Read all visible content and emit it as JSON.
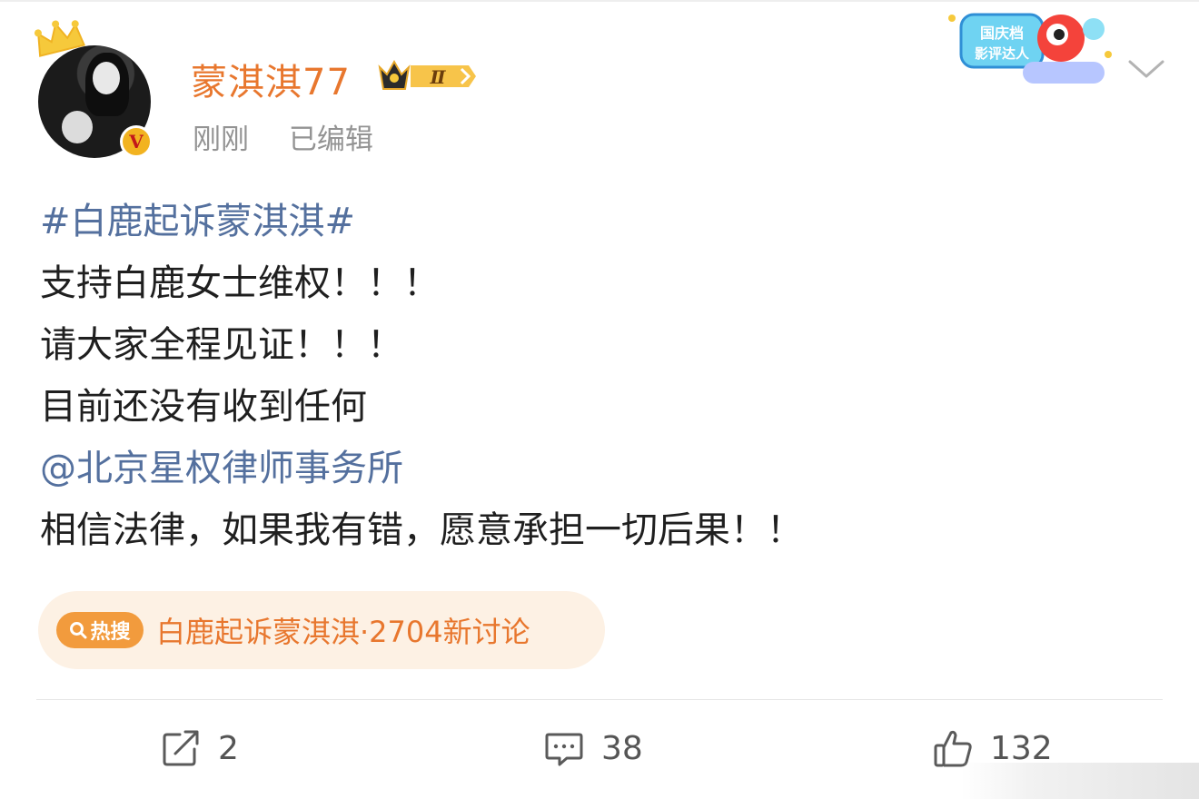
{
  "post": {
    "author": {
      "name": "蒙淇淇77",
      "verified_badge": "V",
      "vip_level": "Ⅱ"
    },
    "meta": {
      "time": "刚刚",
      "edited": "已编辑"
    },
    "promo_badge": {
      "line1": "国庆档",
      "line2": "影评达人"
    },
    "content": {
      "hashtag": "#白鹿起诉蒙淇淇#",
      "line1": "支持白鹿女士维权！！！",
      "line2": "请大家全程见证！！！",
      "line3": "目前还没有收到任何",
      "mention": "@北京星权律师事务所",
      "line4": "相信法律，如果我有错，愿意承担一切后果！！"
    },
    "hot_search": {
      "badge": "热搜",
      "text": "白鹿起诉蒙淇淇·2704新讨论"
    },
    "actions": {
      "repost_count": "2",
      "comment_count": "38",
      "like_count": "132"
    }
  },
  "colors": {
    "username": "#e8772e",
    "link": "#54709e",
    "meta": "#939393",
    "hot_bg": "#fdf1e4",
    "hot_badge": "#f29b3d"
  }
}
